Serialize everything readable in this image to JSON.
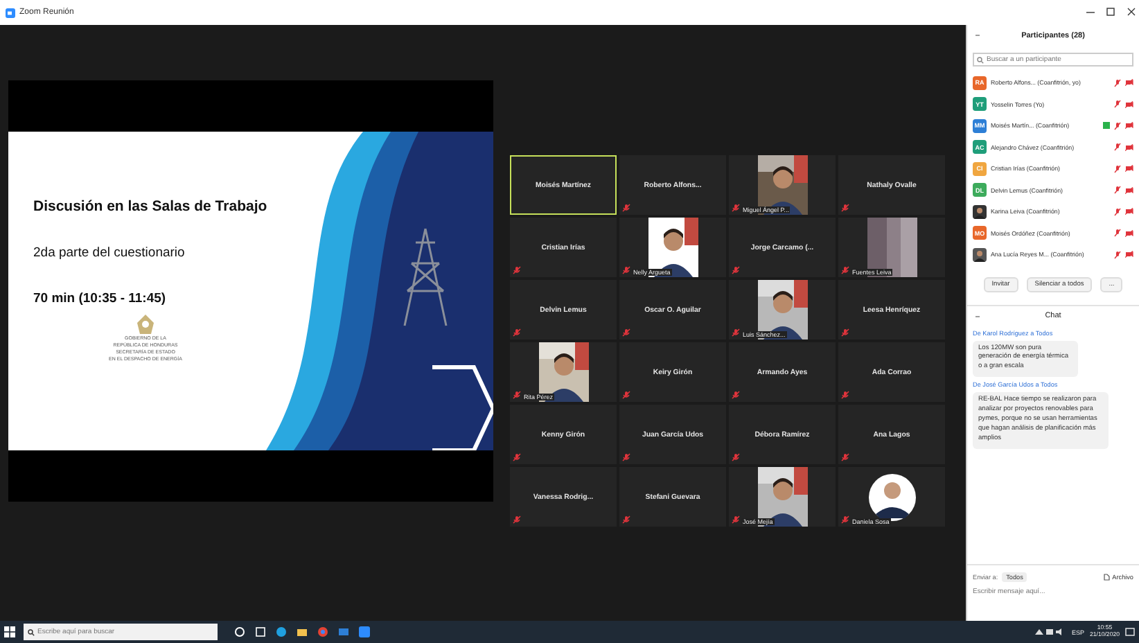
{
  "window": {
    "title": "Zoom Reunión"
  },
  "slide": {
    "title": "Discusión en las Salas de Trabajo",
    "subtitle": "2da parte del cuestionario",
    "time": "70 min (10:35 - 11:45)",
    "logo_lines": [
      "GOBIERNO DE LA",
      "REPÚBLICA DE HONDURAS",
      "SECRETARÍA DE ESTADO",
      "EN EL DESPACHO DE ENERGÍA"
    ]
  },
  "gallery": [
    {
      "name": "Moisés Martínez",
      "kind": "name",
      "active_speaker": true,
      "muted": false
    },
    {
      "name": "Roberto Alfons...",
      "kind": "name",
      "active_speaker": false,
      "muted": true
    },
    {
      "name": "Miguel Ángel P...",
      "active_speaker": false,
      "muted": true
    },
    {
      "name": "Nathaly Ovalle",
      "kind": "name",
      "active_speaker": false,
      "muted": true
    },
    {
      "name": "Cristian Irías",
      "kind": "name",
      "active_speaker": false,
      "muted": true
    },
    {
      "name": "Nelly Argueta",
      "active_speaker": false,
      "muted": true
    },
    {
      "name": "Jorge Carcamo (...",
      "kind": "name",
      "active_speaker": false,
      "muted": true
    },
    {
      "name": "Fuentes Leiva",
      "kind": "blur",
      "active_speaker": false,
      "muted": true
    },
    {
      "name": "Delvin Lemus",
      "kind": "name",
      "active_speaker": false,
      "muted": true
    },
    {
      "name": "Oscar O. Aguilar",
      "kind": "name",
      "active_speaker": false,
      "muted": true
    },
    {
      "name": "Luis Sánchez...",
      "active_speaker": false,
      "muted": true
    },
    {
      "name": "Leesa Henríquez",
      "kind": "name",
      "active_speaker": false,
      "muted": true
    },
    {
      "name": "Rita Pérez",
      "active_speaker": false,
      "muted": true
    },
    {
      "name": "Keiry Girón",
      "kind": "name",
      "active_speaker": false,
      "muted": true
    },
    {
      "name": "Armando Ayes",
      "kind": "name",
      "active_speaker": false,
      "muted": true
    },
    {
      "name": "Ada Corrao",
      "kind": "name",
      "active_speaker": false,
      "muted": true
    },
    {
      "name": "Kenny Girón",
      "kind": "name",
      "active_speaker": false,
      "muted": true
    },
    {
      "name": "Juan García Udos",
      "kind": "name",
      "active_speaker": false,
      "muted": true
    },
    {
      "name": "Débora Ramírez",
      "kind": "name",
      "active_speaker": false,
      "muted": true
    },
    {
      "name": "Ana Lagos",
      "kind": "name",
      "active_speaker": false,
      "muted": true
    },
    {
      "name": "Vanessa Rodrig...",
      "kind": "name",
      "active_speaker": false,
      "muted": true
    },
    {
      "name": "Stefani Guevara",
      "kind": "name",
      "active_speaker": false,
      "muted": true
    },
    {
      "name": "José Mejía",
      "active_speaker": false,
      "muted": true
    },
    {
      "name": "Daniela Sosa",
      "kind": "round",
      "active_speaker": false,
      "muted": true
    }
  ],
  "participants": {
    "title": "Participantes (28)",
    "search_placeholder": "Buscar a un participante",
    "items": [
      {
        "kind": "initials",
        "initials": "RA",
        "color": "#e8672a",
        "name": "Roberto Alfons... (Coanfitrión, yo)",
        "sharing": false
      },
      {
        "kind": "initials",
        "initials": "YT",
        "color": "#1f9e7a",
        "name": "Yosselin Torres (Yo)",
        "sharing": false
      },
      {
        "kind": "initials",
        "initials": "MM",
        "color": "#2d7fd6",
        "name": "Moisés Martín... (Coanfitrión)",
        "sharing": true
      },
      {
        "kind": "initials",
        "initials": "AC",
        "color": "#1f9e7a",
        "name": "Alejandro Chávez (Coanfitrión)",
        "sharing": false
      },
      {
        "kind": "initials",
        "initials": "CI",
        "color": "#f0a640",
        "name": "Cristian Irías (Coanfitrión)",
        "sharing": false
      },
      {
        "kind": "initials",
        "initials": "DL",
        "color": "#3dab5c",
        "name": "Delvin Lemus (Coanfitrión)",
        "sharing": false
      },
      {
        "color": "#333333",
        "name": "Karina Leiva (Coanfitrión)",
        "sharing": false
      },
      {
        "kind": "initials",
        "initials": "MO",
        "color": "#e8672a",
        "name": "Moisés Ordóñez (Coanfitrión)",
        "sharing": false
      },
      {
        "color": "#555555",
        "name": "Ana Lucía Reyes M... (Coanfitrión)",
        "sharing": false
      }
    ],
    "buttons": [
      "Invitar",
      "Silenciar a todos",
      "..."
    ]
  },
  "chat": {
    "title": "Chat",
    "messages": [
      {
        "sender": "De Karol Rodríguez a Todos",
        "text": "Los 120MW son pura generación de energía térmica o a gran escala"
      },
      {
        "sender": "De José García Udos a Todos",
        "text": "RE-BAL Hace tiempo se realizaron para analizar por proyectos renovables para pymes, porque no se usan herramientas que hagan análisis de planificación más amplios"
      }
    ],
    "to_label": "Enviar a:",
    "to_value": "Todos",
    "file_button": "Archivo",
    "placeholder": "Escribir mensaje aquí..."
  },
  "taskbar": {
    "search_placeholder": "Escribe aquí para buscar",
    "language": "ESP",
    "time": "10:55",
    "date": "21/10/2020"
  }
}
